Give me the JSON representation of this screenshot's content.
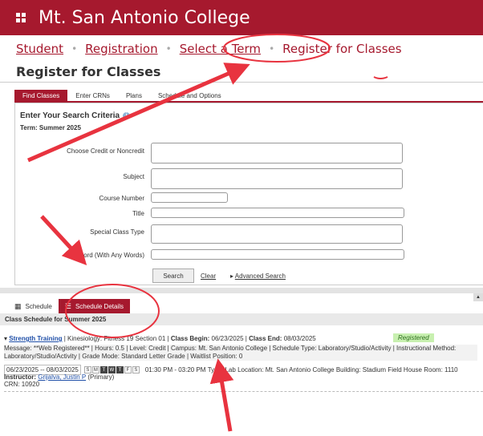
{
  "header": {
    "app_title": "Mt. San Antonio College"
  },
  "breadcrumb": {
    "items": [
      "Student",
      "Registration",
      "Select a Term"
    ],
    "current": "Register for Classes",
    "separator": "•"
  },
  "page_title": "Register for Classes",
  "tabs": [
    "Find Classes",
    "Enter CRNs",
    "Plans",
    "Schedule and Options"
  ],
  "search": {
    "heading": "Enter Your Search Criteria",
    "term": "Term: Summer 2025",
    "labels": {
      "credit": "Choose Credit or Noncredit",
      "subject": "Subject",
      "course_number": "Course Number",
      "title": "Title",
      "special_type": "Special Class Type",
      "keyword": "Keyword (With Any Words)"
    },
    "search_button": "Search",
    "clear_link": "Clear",
    "advanced_link": "Advanced Search"
  },
  "schedule": {
    "tab_schedule": "Schedule",
    "tab_details": "Schedule Details",
    "header": "Class Schedule for Summer 2025",
    "class": {
      "title": "Strength Training",
      "rest": " | Kinesiology: Fitness 19 Section 01 | ",
      "begin_label": "Class Begin:",
      "begin": "06/23/2025",
      "end_label": "Class End:",
      "end": "08/03/2025",
      "status": "Registered"
    },
    "message_line": "Message: **Web Registered** | Hours: 0.5 | Level: Credit | Campus: Mt. San Antonio College | Schedule Type: Laboratory/Studio/Activity | Instructional Method: Laboratory/Studio/Activity | Grade Mode: Standard Letter Grade | Waitlist Position: 0",
    "meeting": {
      "dates": "06/23/2025 -- 08/03/2025",
      "days": [
        "S",
        "M",
        "T",
        "W",
        "T",
        "F",
        "S"
      ],
      "time": "01:30 PM - 03:20 PM",
      "type": "Type: Lab",
      "location": "Location: Mt. San Antonio College",
      "building": "Building: Stadium Field House",
      "room": "Room: 1110"
    },
    "instructor_label": "Instructor:",
    "instructor": "Grijalva, Justin P",
    "instructor_role": "(Primary)",
    "crn": "CRN: 10920"
  },
  "colors": {
    "brand": "#a6192e",
    "annotation": "#e8333f",
    "registered_bg": "#c8f0b0"
  }
}
